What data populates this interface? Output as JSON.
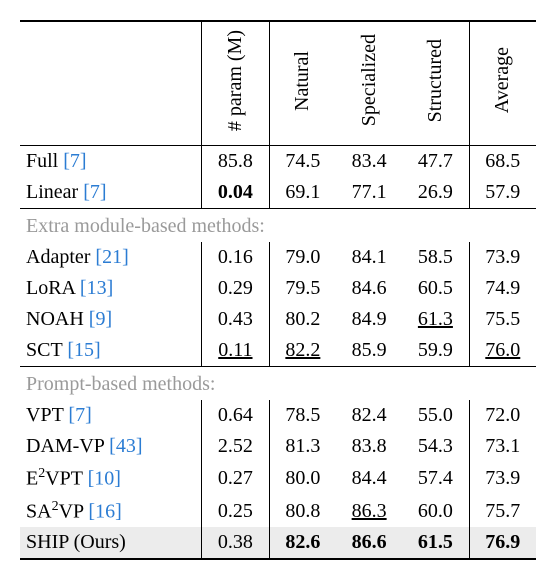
{
  "headers": {
    "method": "",
    "param": "# param (M)",
    "natural": "Natural",
    "specialized": "Specialized",
    "structured": "Structured",
    "average": "Average"
  },
  "group_labels": {
    "extra": "Extra module-based methods:",
    "prompt": "Prompt-based methods:"
  },
  "rows": {
    "full": {
      "name": "Full",
      "cite": "[7]",
      "param": "85.8",
      "nat": "74.5",
      "spec": "83.4",
      "str": "47.7",
      "avg": "68.5"
    },
    "linear": {
      "name": "Linear",
      "cite": "[7]",
      "param": "0.04",
      "nat": "69.1",
      "spec": "77.1",
      "str": "26.9",
      "avg": "57.9"
    },
    "adapter": {
      "name": "Adapter",
      "cite": "[21]",
      "param": "0.16",
      "nat": "79.0",
      "spec": "84.1",
      "str": "58.5",
      "avg": "73.9"
    },
    "lora": {
      "name": "LoRA",
      "cite": "[13]",
      "param": "0.29",
      "nat": "79.5",
      "spec": "84.6",
      "str": "60.5",
      "avg": "74.9"
    },
    "noah": {
      "name": "NOAH",
      "cite": "[9]",
      "param": "0.43",
      "nat": "80.2",
      "spec": "84.9",
      "str": "61.3",
      "avg": "75.5"
    },
    "sct": {
      "name": "SCT",
      "cite": "[15]",
      "param": "0.11",
      "nat": "82.2",
      "spec": "85.9",
      "str": "59.9",
      "avg": "76.0"
    },
    "vpt": {
      "name": "VPT",
      "cite": "[7]",
      "param": "0.64",
      "nat": "78.5",
      "spec": "82.4",
      "str": "55.0",
      "avg": "72.0"
    },
    "damvp": {
      "name": "DAM-VP",
      "cite": "[43]",
      "param": "2.52",
      "nat": "81.3",
      "spec": "83.8",
      "str": "54.3",
      "avg": "73.1"
    },
    "e2vpt": {
      "name_prefix": "E",
      "sup": "2",
      "name_suffix": "VPT",
      "cite": "[10]",
      "param": "0.27",
      "nat": "80.0",
      "spec": "84.4",
      "str": "57.4",
      "avg": "73.9"
    },
    "sa2vp": {
      "name_prefix": "SA",
      "sup": "2",
      "name_suffix": "VP",
      "cite": "[16]",
      "param": "0.25",
      "nat": "80.8",
      "spec": "86.3",
      "str": "60.0",
      "avg": "75.7"
    },
    "ship": {
      "name": "SHIP (Ours)",
      "param": "0.38",
      "nat": "82.6",
      "spec": "86.6",
      "str": "61.5",
      "avg": "76.9"
    }
  },
  "chart_data": {
    "type": "table",
    "columns": [
      "Method",
      "# param (M)",
      "Natural",
      "Specialized",
      "Structured",
      "Average"
    ],
    "rows": [
      [
        "Full [7]",
        85.8,
        74.5,
        83.4,
        47.7,
        68.5
      ],
      [
        "Linear [7]",
        0.04,
        69.1,
        77.1,
        26.9,
        57.9
      ],
      [
        "Adapter [21]",
        0.16,
        79.0,
        84.1,
        58.5,
        73.9
      ],
      [
        "LoRA [13]",
        0.29,
        79.5,
        84.6,
        60.5,
        74.9
      ],
      [
        "NOAH [9]",
        0.43,
        80.2,
        84.9,
        61.3,
        75.5
      ],
      [
        "SCT [15]",
        0.11,
        82.2,
        85.9,
        59.9,
        76.0
      ],
      [
        "VPT [7]",
        0.64,
        78.5,
        82.4,
        55.0,
        72.0
      ],
      [
        "DAM-VP [43]",
        2.52,
        81.3,
        83.8,
        54.3,
        73.1
      ],
      [
        "E2VPT [10]",
        0.27,
        80.0,
        84.4,
        57.4,
        73.9
      ],
      [
        "SA2VP [16]",
        0.25,
        80.8,
        86.3,
        60.0,
        75.7
      ],
      [
        "SHIP (Ours)",
        0.38,
        82.6,
        86.6,
        61.5,
        76.9
      ]
    ],
    "groups": [
      {
        "label": "Extra module-based methods:",
        "rows": [
          "Adapter [21]",
          "LoRA [13]",
          "NOAH [9]",
          "SCT [15]"
        ]
      },
      {
        "label": "Prompt-based methods:",
        "rows": [
          "VPT [7]",
          "DAM-VP [43]",
          "E2VPT [10]",
          "SA2VP [16]",
          "SHIP (Ours)"
        ]
      }
    ],
    "emphasis": {
      "bold": {
        "Linear [7]": "# param (M)",
        "SHIP (Ours)": [
          "Natural",
          "Specialized",
          "Structured",
          "Average"
        ]
      },
      "underline": {
        "SCT [15]": [
          "# param (M)",
          "Natural",
          "Average"
        ],
        "NOAH [9]": "Structured",
        "SA2VP [16]": "Specialized"
      }
    }
  }
}
